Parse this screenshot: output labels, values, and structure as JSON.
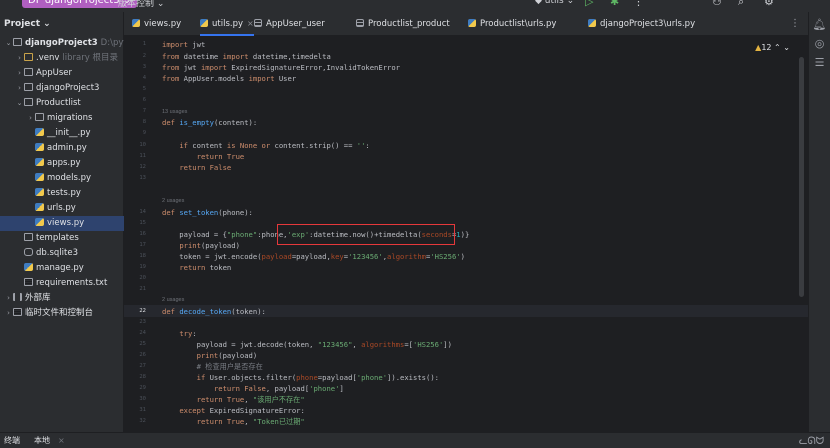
{
  "titlebar": {
    "project_badge": "DP",
    "project_name": "djangoProject3",
    "vcs": "版本控制",
    "run_config": "utils"
  },
  "project_panel": {
    "title": "Project",
    "tree": [
      {
        "label": "djangoProject3",
        "extra": "D:\\python",
        "indent": 0,
        "chev": "v",
        "icon": "folder",
        "bold": true
      },
      {
        "label": ".venv",
        "extra": "library 根目录",
        "indent": 1,
        "chev": ">",
        "icon": "folder-venv"
      },
      {
        "label": "AppUser",
        "extra": "",
        "indent": 1,
        "chev": ">",
        "icon": "folder"
      },
      {
        "label": "djangoProject3",
        "extra": "",
        "indent": 1,
        "chev": ">",
        "icon": "folder"
      },
      {
        "label": "Productlist",
        "extra": "",
        "indent": 1,
        "chev": "v",
        "icon": "folder"
      },
      {
        "label": "migrations",
        "extra": "",
        "indent": 2,
        "chev": ">",
        "icon": "folder"
      },
      {
        "label": "__init__.py",
        "extra": "",
        "indent": 2,
        "chev": "",
        "icon": "py"
      },
      {
        "label": "admin.py",
        "extra": "",
        "indent": 2,
        "chev": "",
        "icon": "py"
      },
      {
        "label": "apps.py",
        "extra": "",
        "indent": 2,
        "chev": "",
        "icon": "py"
      },
      {
        "label": "models.py",
        "extra": "",
        "indent": 2,
        "chev": "",
        "icon": "py"
      },
      {
        "label": "tests.py",
        "extra": "",
        "indent": 2,
        "chev": "",
        "icon": "py"
      },
      {
        "label": "urls.py",
        "extra": "",
        "indent": 2,
        "chev": "",
        "icon": "py"
      },
      {
        "label": "views.py",
        "extra": "",
        "indent": 2,
        "chev": "",
        "icon": "py",
        "selected": true
      },
      {
        "label": "templates",
        "extra": "",
        "indent": 1,
        "chev": "",
        "icon": "folder"
      },
      {
        "label": "db.sqlite3",
        "extra": "",
        "indent": 1,
        "chev": "",
        "icon": "db"
      },
      {
        "label": "manage.py",
        "extra": "",
        "indent": 1,
        "chev": "",
        "icon": "py"
      },
      {
        "label": "requirements.txt",
        "extra": "",
        "indent": 1,
        "chev": "",
        "icon": "txt"
      },
      {
        "label": "外部库",
        "extra": "",
        "indent": 0,
        "chev": ">",
        "icon": "lib"
      },
      {
        "label": "临时文件和控制台",
        "extra": "",
        "indent": 0,
        "chev": ">",
        "icon": "txt"
      }
    ]
  },
  "tabs": [
    {
      "label": "views.py",
      "icon": "py",
      "active": false,
      "closable": false
    },
    {
      "label": "utils.py",
      "icon": "py",
      "active": true,
      "closable": true
    },
    {
      "label": "AppUser_user",
      "icon": "tbl",
      "active": false,
      "closable": false
    },
    {
      "label": "Productlist_product",
      "icon": "tbl",
      "active": false,
      "closable": false
    },
    {
      "label": "Productlist\\urls.py",
      "icon": "py",
      "active": false,
      "closable": false
    },
    {
      "label": "djangoProject3\\urls.py",
      "icon": "py",
      "active": false,
      "closable": false
    }
  ],
  "editor": {
    "warnings": "12",
    "usages": [
      "13 usages",
      "2 usages",
      "2 usages"
    ],
    "current_line": 22
  },
  "bottom": {
    "terminal": "终端",
    "local": "本地",
    "close": "×"
  },
  "colors": {
    "accent": "#3574f0",
    "selection": "#2e436e",
    "highlight_box": "#e5383b"
  }
}
